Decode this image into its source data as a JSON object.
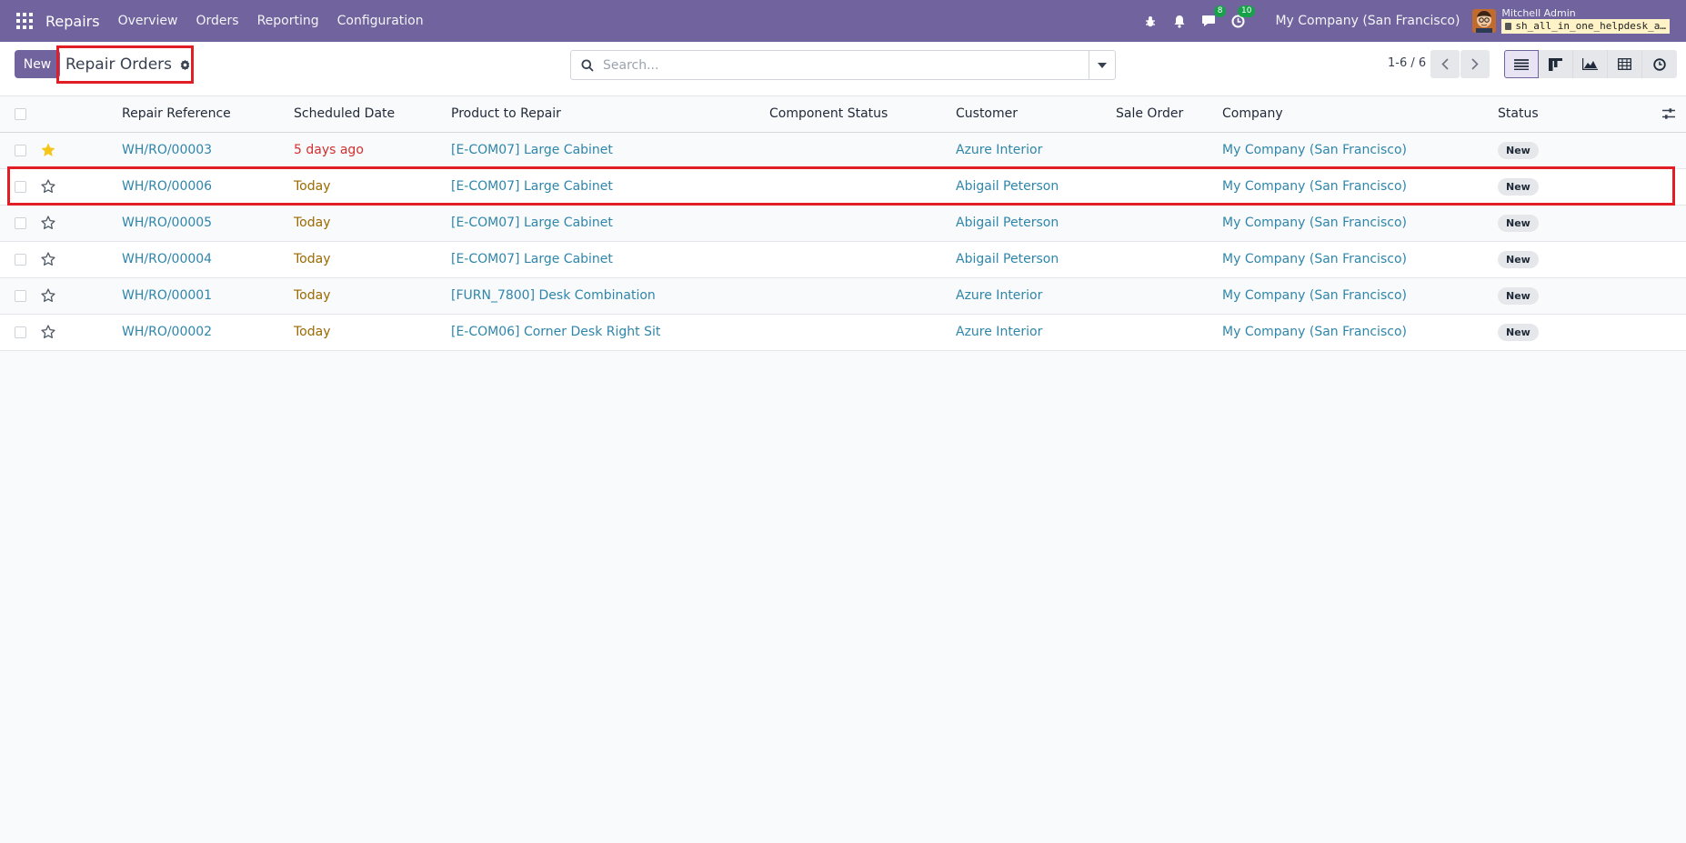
{
  "app": {
    "name": "Repairs"
  },
  "menu": [
    "Overview",
    "Orders",
    "Reporting",
    "Configuration"
  ],
  "systray": {
    "messages_count": "8",
    "activities_count": "10",
    "company": "My Company (San Francisco)",
    "user_name": "Mitchell Admin",
    "database": "sh_all_in_one_helpdesk_a…"
  },
  "control": {
    "new_label": "New",
    "title": "Repair Orders",
    "search_placeholder": "Search...",
    "pager": "1-6 / 6"
  },
  "table": {
    "columns": [
      "Repair Reference",
      "Scheduled Date",
      "Product to Repair",
      "Component Status",
      "Customer",
      "Sale Order",
      "Company",
      "Status"
    ],
    "rows": [
      {
        "ref": "WH/RO/00003",
        "date": "5 days ago",
        "late": true,
        "starred": true,
        "product": "[E-COM07] Large Cabinet",
        "customer": "Azure Interior",
        "company": "My Company (San Francisco)",
        "status": "New"
      },
      {
        "ref": "WH/RO/00006",
        "date": "Today",
        "late": false,
        "starred": false,
        "product": "[E-COM07] Large Cabinet",
        "customer": "Abigail Peterson",
        "company": "My Company (San Francisco)",
        "status": "New"
      },
      {
        "ref": "WH/RO/00005",
        "date": "Today",
        "late": false,
        "starred": false,
        "product": "[E-COM07] Large Cabinet",
        "customer": "Abigail Peterson",
        "company": "My Company (San Francisco)",
        "status": "New"
      },
      {
        "ref": "WH/RO/00004",
        "date": "Today",
        "late": false,
        "starred": false,
        "product": "[E-COM07] Large Cabinet",
        "customer": "Abigail Peterson",
        "company": "My Company (San Francisco)",
        "status": "New"
      },
      {
        "ref": "WH/RO/00001",
        "date": "Today",
        "late": false,
        "starred": false,
        "product": "[FURN_7800] Desk Combination",
        "customer": "Azure Interior",
        "company": "My Company (San Francisco)",
        "status": "New"
      },
      {
        "ref": "WH/RO/00002",
        "date": "Today",
        "late": false,
        "starred": false,
        "product": "[E-COM06] Corner Desk Right Sit",
        "customer": "Azure Interior",
        "company": "My Company (San Francisco)",
        "status": "New"
      }
    ]
  },
  "colors": {
    "brand": "#71639e",
    "link": "#2e86ab",
    "late": "#d32f2f",
    "today": "#9a6a00",
    "highlight": "#e11d26"
  }
}
